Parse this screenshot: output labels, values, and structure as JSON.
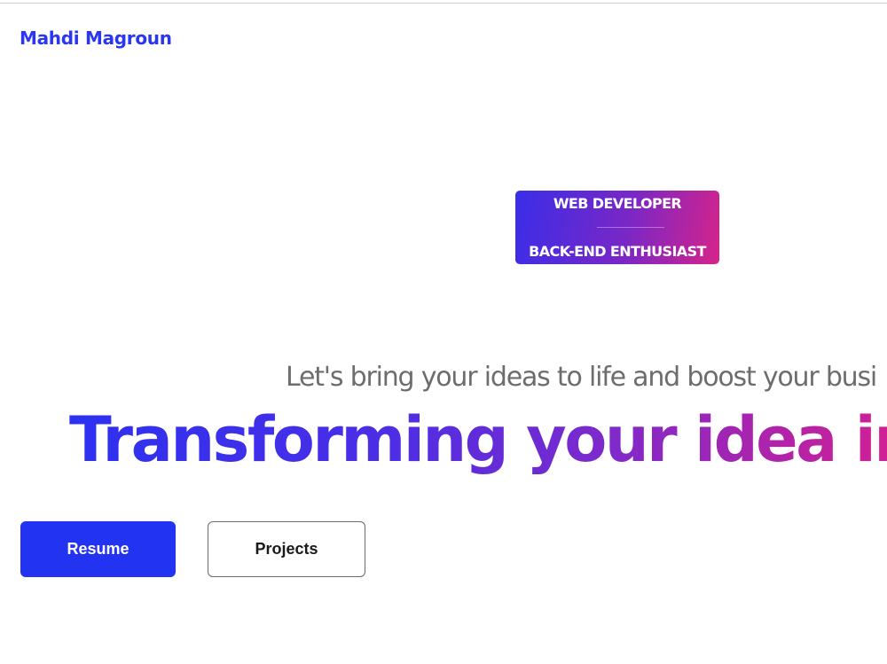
{
  "brand": {
    "name": "Mahdi Magroun"
  },
  "hero": {
    "roles": [
      "WEB DEVELOPER",
      "BACK-END ENTHUSIAST"
    ],
    "tagline": "Let's bring your ideas to life and boost your busi",
    "headline": "Transforming your idea into",
    "headline_gradient": [
      "#2c31f0",
      "#d6238a"
    ]
  },
  "actions": {
    "resume_label": "Resume",
    "projects_label": "Projects"
  },
  "colors": {
    "accent": "#2233f2",
    "badge_start": "#3a2de8",
    "badge_end": "#d6238a"
  }
}
